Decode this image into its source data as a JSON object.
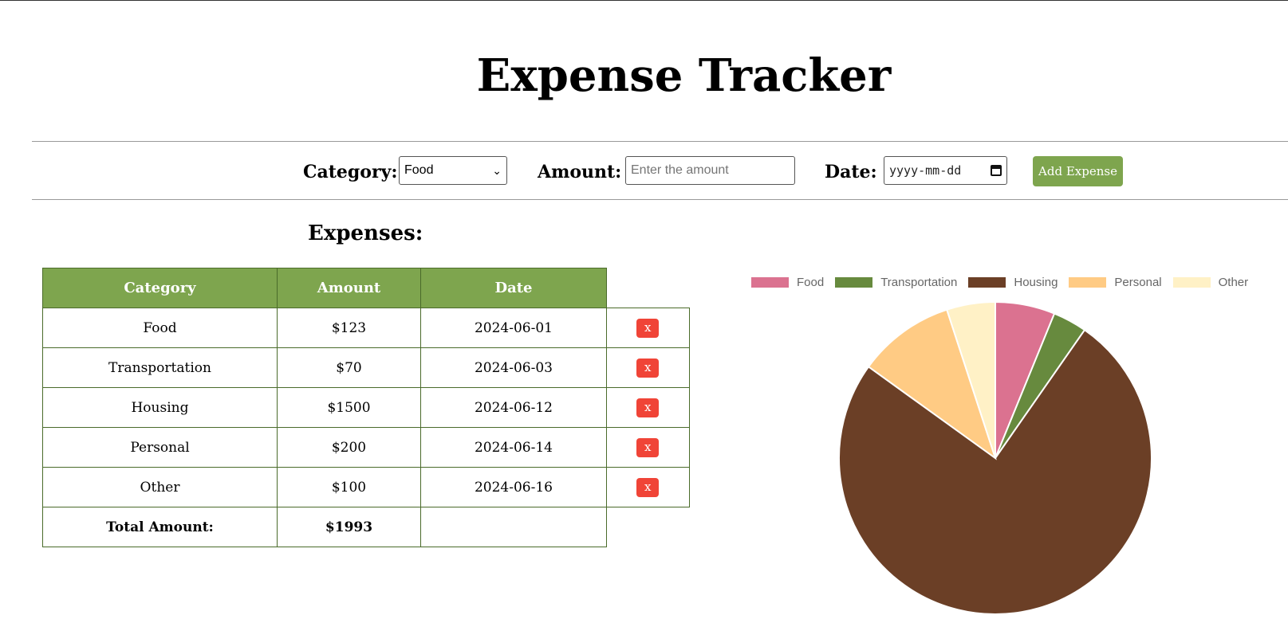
{
  "title": "Expense Tracker",
  "form": {
    "category_label": "Category:",
    "category_value": "Food",
    "amount_label": "Amount:",
    "amount_placeholder": "Enter the amount",
    "date_label": "Date:",
    "date_placeholder": "yyyy-mm-dd",
    "add_button": "Add Expense"
  },
  "expenses_heading": "Expenses:",
  "table": {
    "headers": [
      "Category",
      "Amount",
      "Date"
    ],
    "rows": [
      {
        "category": "Food",
        "amount": "$123",
        "date": "2024-06-01",
        "delete": "x"
      },
      {
        "category": "Transportation",
        "amount": "$70",
        "date": "2024-06-03",
        "delete": "x"
      },
      {
        "category": "Housing",
        "amount": "$1500",
        "date": "2024-06-12",
        "delete": "x"
      },
      {
        "category": "Personal",
        "amount": "$200",
        "date": "2024-06-14",
        "delete": "x"
      },
      {
        "category": "Other",
        "amount": "$100",
        "date": "2024-06-16",
        "delete": "x"
      }
    ],
    "total_label": "Total Amount:",
    "total_value": "$1993"
  },
  "colors": {
    "header_green": "#7ea54e",
    "delete_red": "#f04437"
  },
  "chart_data": {
    "type": "pie",
    "categories": [
      "Food",
      "Transportation",
      "Housing",
      "Personal",
      "Other"
    ],
    "values": [
      123,
      70,
      1500,
      200,
      100
    ],
    "colors": [
      "#db7290",
      "#678a3e",
      "#6b3f26",
      "#ffcb84",
      "#fff1c6"
    ],
    "legend_position": "top"
  }
}
